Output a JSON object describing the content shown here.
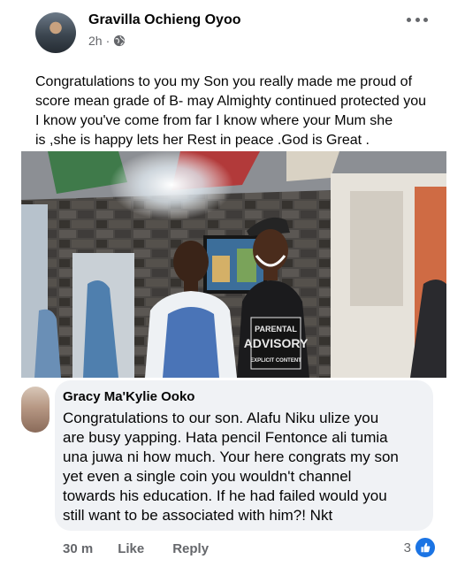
{
  "post": {
    "author": "Gravilla Ochieng Oyoo",
    "time": "2h",
    "privacy_icon": "globe-icon",
    "text_lines": [
      "Congratulations to you my Son you really made me  proud of",
      "score mean grade of B- may Almighty continued protected you",
      "I know you've come from far I know where your Mum she",
      "is ,she is happy lets her Rest in peace .God is Great ."
    ]
  },
  "photo": {
    "shirt_text": [
      "PARENTAL",
      "ADVISORY",
      "EXPLICIT CONTENT"
    ]
  },
  "comment": {
    "author": "Gracy Ma'Kylie Ooko",
    "text_lines": [
      "Congratulations to our son. Alafu Niku ulize you",
      "are busy yapping. Hata pencil Fentonce ali tumia",
      "una juwa ni how much. Your here congrats my son",
      "yet even a single coin you wouldn't channel",
      "towards his education. If he had failed would you",
      "still want to be associated with him?! Nkt"
    ],
    "age": "30 m",
    "like_label": "Like",
    "reply_label": "Reply",
    "reaction_count": "3",
    "reaction_icon": "thumbs-up-icon"
  },
  "colors": {
    "bubble": "#f0f2f5",
    "meta": "#65676b",
    "like_blue": "#1b74e4"
  }
}
